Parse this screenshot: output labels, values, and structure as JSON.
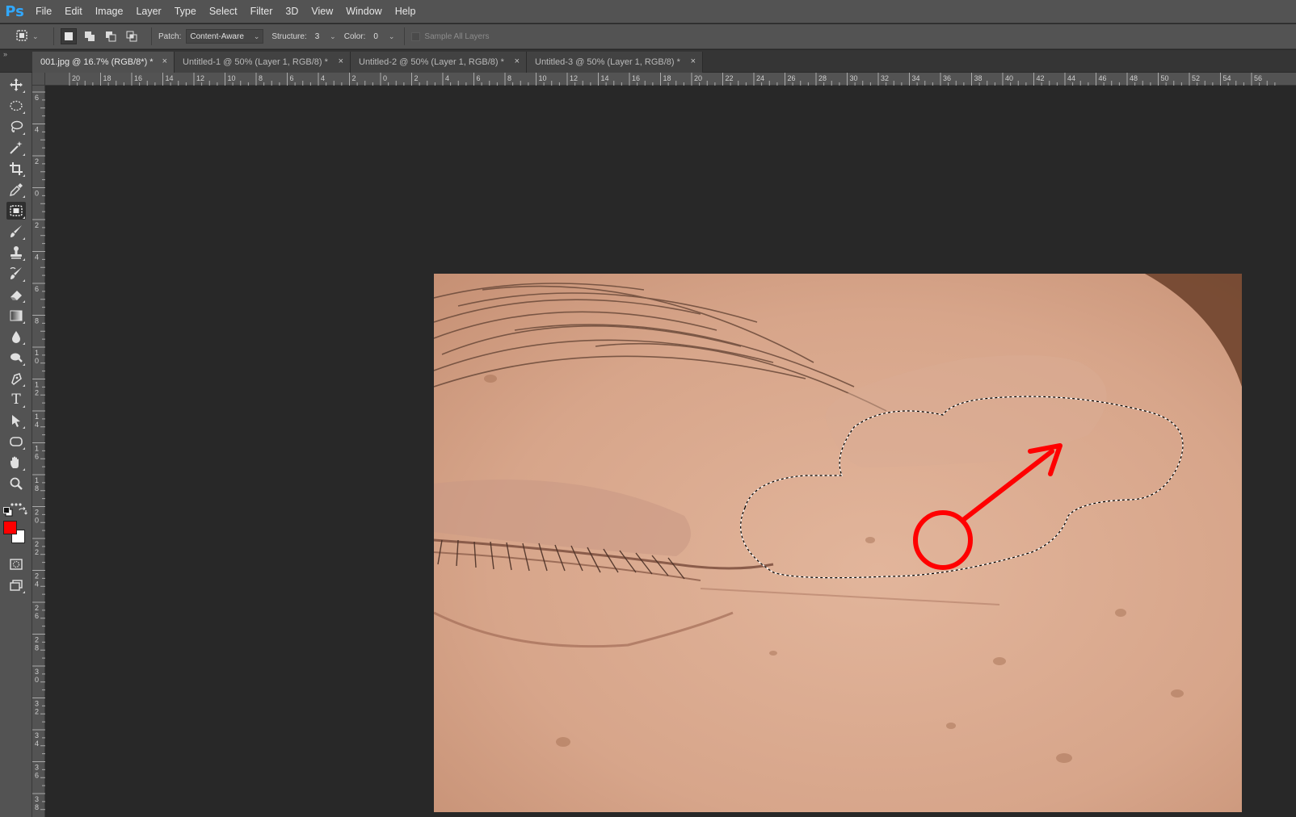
{
  "app": {
    "logo": "Ps"
  },
  "menu": [
    "File",
    "Edit",
    "Image",
    "Layer",
    "Type",
    "Select",
    "Filter",
    "3D",
    "View",
    "Window",
    "Help"
  ],
  "options": {
    "tool_icon": "patch-tool-icon",
    "patch_label": "Patch:",
    "patch_value": "Content-Aware",
    "structure_label": "Structure:",
    "structure_value": "3",
    "color_label": "Color:",
    "color_value": "0",
    "sample_all_layers": "Sample All Layers",
    "sample_all_checked": false
  },
  "tabs": [
    {
      "label": "001.jpg @ 16.7% (RGB/8*) *",
      "active": true
    },
    {
      "label": "Untitled-1 @ 50% (Layer 1, RGB/8) *",
      "active": false
    },
    {
      "label": "Untitled-2 @ 50% (Layer 1, RGB/8) *",
      "active": false
    },
    {
      "label": "Untitled-3 @ 50% (Layer 1, RGB/8) *",
      "active": false
    }
  ],
  "tabs_close_glyph": "×",
  "ruler_top_labels": [
    "20",
    "18",
    "16",
    "14",
    "12",
    "10",
    "8",
    "6",
    "4",
    "2",
    "0",
    "2",
    "4",
    "6",
    "8",
    "10",
    "12",
    "14",
    "16",
    "18",
    "20",
    "22",
    "24",
    "26",
    "28",
    "30",
    "32",
    "34",
    "36",
    "38",
    "40",
    "42",
    "44",
    "46",
    "48",
    "50",
    "52",
    "54",
    "56"
  ],
  "ruler_left_labels": [
    "6",
    "4",
    "2",
    "0",
    "2",
    "4",
    "6",
    "8",
    "10",
    "12",
    "14",
    "16",
    "18",
    "20",
    "22",
    "24",
    "26",
    "28",
    "30",
    "32",
    "34",
    "36",
    "38"
  ],
  "colors": {
    "foreground": "#ff0000",
    "background": "#ffffff",
    "annotation": "#ff0000"
  },
  "tools": [
    "move-tool-icon",
    "marquee-tool-icon",
    "lasso-tool-icon",
    "magic-wand-tool-icon",
    "crop-tool-icon",
    "eyedropper-tool-icon",
    "patch-tool-icon",
    "brush-tool-icon",
    "clone-stamp-tool-icon",
    "history-brush-tool-icon",
    "eraser-tool-icon",
    "gradient-tool-icon",
    "blur-tool-icon",
    "dodge-tool-icon",
    "pen-tool-icon",
    "type-tool-icon",
    "path-selection-tool-icon",
    "shape-tool-icon",
    "hand-tool-icon",
    "zoom-tool-icon",
    "more-tools-icon"
  ],
  "type_tool_glyph": "T"
}
